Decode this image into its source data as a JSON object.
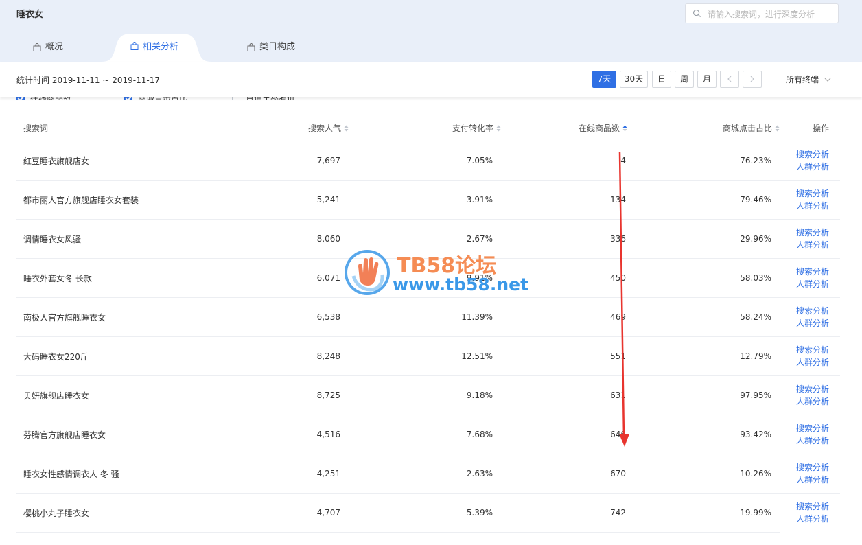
{
  "header": {
    "title": "睡衣女",
    "search_placeholder": "请输入搜索词，进行深度分析"
  },
  "tabs": [
    {
      "label": "概况",
      "active": false
    },
    {
      "label": "相关分析",
      "active": true
    },
    {
      "label": "类目构成",
      "active": false
    }
  ],
  "toolbar": {
    "stat_time": "统计时间 2019-11-11 ~ 2019-11-17",
    "periods": [
      "7天",
      "30天",
      "日",
      "周",
      "月"
    ],
    "active_period": "7天",
    "terminal": "所有终端"
  },
  "checkboxes": [
    {
      "label": "在线商品数",
      "checked": true
    },
    {
      "label": "商城点击占比",
      "checked": true
    },
    {
      "label": "直通车参考价",
      "checked": false
    }
  ],
  "table": {
    "headers": [
      "搜索词",
      "搜索人气",
      "支付转化率",
      "在线商品数",
      "商城点击占比",
      "操作"
    ],
    "sorted_column": "在线商品数",
    "rows": [
      {
        "keyword": "红豆睡衣旗舰店女",
        "popularity": "7,697",
        "conversion": "7.05%",
        "online_items": "4",
        "mall_click": "76.23%"
      },
      {
        "keyword": "都市丽人官方旗舰店睡衣女套装",
        "popularity": "5,241",
        "conversion": "3.91%",
        "online_items": "134",
        "mall_click": "79.46%"
      },
      {
        "keyword": "调情睡衣女风骚",
        "popularity": "8,060",
        "conversion": "2.67%",
        "online_items": "336",
        "mall_click": "29.96%"
      },
      {
        "keyword": "睡衣外套女冬 长款",
        "popularity": "6,071",
        "conversion": "9.91%",
        "online_items": "450",
        "mall_click": "58.03%"
      },
      {
        "keyword": "南极人官方旗舰睡衣女",
        "popularity": "6,538",
        "conversion": "11.39%",
        "online_items": "469",
        "mall_click": "58.24%"
      },
      {
        "keyword": "大码睡衣女220斤",
        "popularity": "8,248",
        "conversion": "12.51%",
        "online_items": "551",
        "mall_click": "12.79%"
      },
      {
        "keyword": "贝妍旗舰店睡衣女",
        "popularity": "8,725",
        "conversion": "9.18%",
        "online_items": "631",
        "mall_click": "97.95%"
      },
      {
        "keyword": "芬腾官方旗舰店睡衣女",
        "popularity": "4,516",
        "conversion": "7.68%",
        "online_items": "646",
        "mall_click": "93.42%"
      },
      {
        "keyword": "睡衣女性感情调衣人 冬 骚",
        "popularity": "4,251",
        "conversion": "2.63%",
        "online_items": "670",
        "mall_click": "10.26%"
      },
      {
        "keyword": "樱桃小丸子睡衣女",
        "popularity": "4,707",
        "conversion": "5.39%",
        "online_items": "742",
        "mall_click": "19.99%"
      }
    ],
    "actions": [
      "搜索分析",
      "人群分析"
    ]
  },
  "watermark": {
    "title": "TB58论坛",
    "url": "www.tb58.net"
  },
  "colors": {
    "accent": "#2f6fe4",
    "header_bg": "#e9eff9",
    "annotation_arrow": "#e8342e"
  }
}
